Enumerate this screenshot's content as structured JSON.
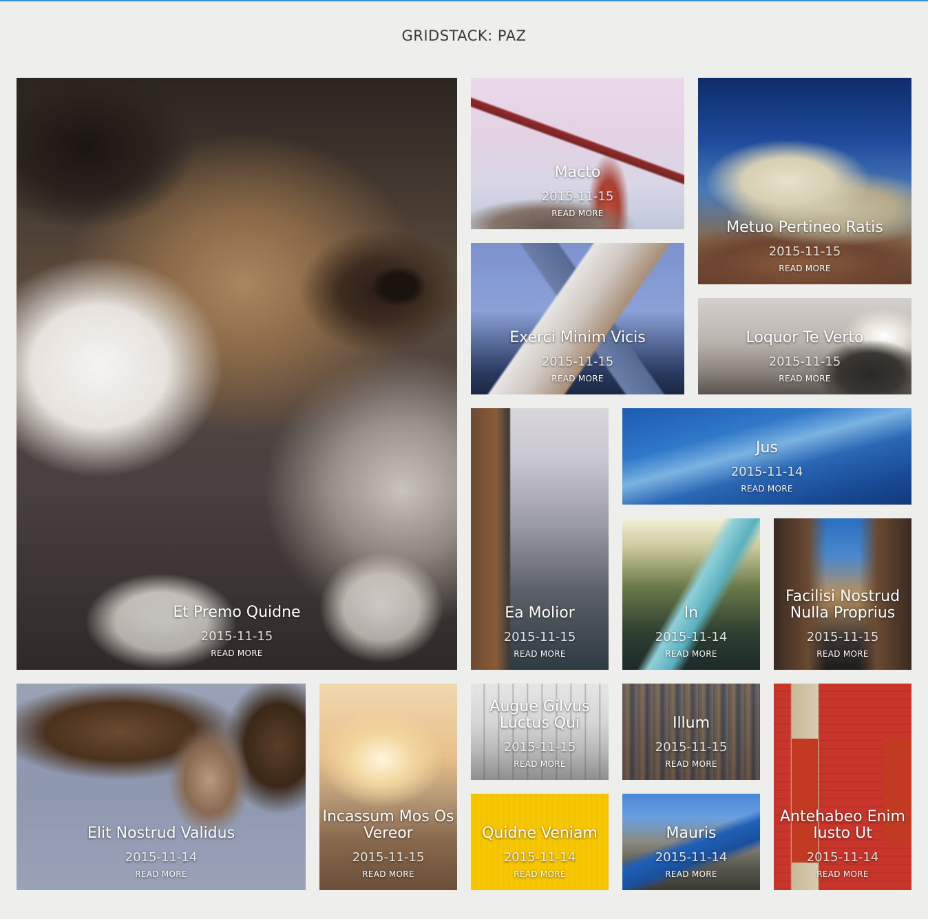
{
  "page": {
    "title": "GRIDSTACK: PAZ"
  },
  "read_more": "READ MORE",
  "tiles": [
    {
      "title": "Et Premo Quidne",
      "date": "2015-11-15"
    },
    {
      "title": "Macto",
      "date": "2015-11-15"
    },
    {
      "title": "Metuo Pertineo Ratis",
      "date": "2015-11-15"
    },
    {
      "title": "Exerci Minim Vicis",
      "date": "2015-11-15"
    },
    {
      "title": "Loquor Te Verto",
      "date": "2015-11-15"
    },
    {
      "title": "Ea Molior",
      "date": "2015-11-15"
    },
    {
      "title": "Jus",
      "date": "2015-11-14"
    },
    {
      "title": "In",
      "date": "2015-11-14"
    },
    {
      "title": "Facilisi Nostrud Nulla Proprius",
      "date": "2015-11-15"
    },
    {
      "title": "Elit Nostrud Validus",
      "date": "2015-11-14"
    },
    {
      "title": "Incassum Mos Os Vereor",
      "date": "2015-11-15"
    },
    {
      "title": "Augue Gilvus Luctus Qui",
      "date": "2015-11-15"
    },
    {
      "title": "Illum",
      "date": "2015-11-15"
    },
    {
      "title": "Antehabeo Enim Iusto Ut",
      "date": "2015-11-14"
    },
    {
      "title": "Quidne Veniam",
      "date": "2015-11-14"
    },
    {
      "title": "Mauris",
      "date": "2015-11-14"
    }
  ]
}
